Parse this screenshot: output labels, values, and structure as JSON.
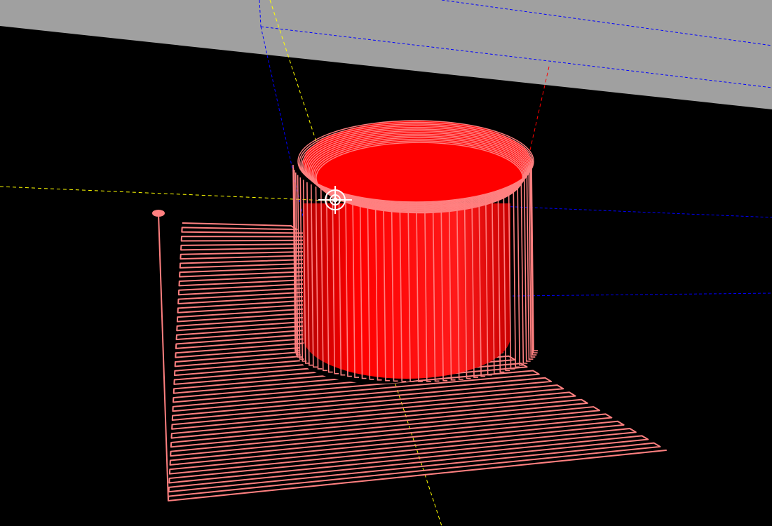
{
  "viewport": {
    "background_color": "#000000",
    "projection": "perspective"
  },
  "scene": {
    "build_plate": {
      "color": "#a0a0a0",
      "visible": true
    },
    "bounding_box": {
      "color": "#0000ff",
      "style": "dashed"
    },
    "axes": {
      "x_axis_color": "#ffff00",
      "y_axis_color": "#ffff00",
      "z_axis_color": "#ff0000",
      "style": "dashed"
    },
    "object": {
      "shape": "cylinder",
      "solid_color": "#ff0000",
      "toolpath_color": "#ff8080"
    },
    "toolpaths": {
      "raster_base_color": "#ff8080",
      "wall_outline_color": "#ff8080",
      "travel_move_color": "#ff8080"
    },
    "camera_target": {
      "icon": "crosshair-icon",
      "color": "#ffffff"
    }
  }
}
